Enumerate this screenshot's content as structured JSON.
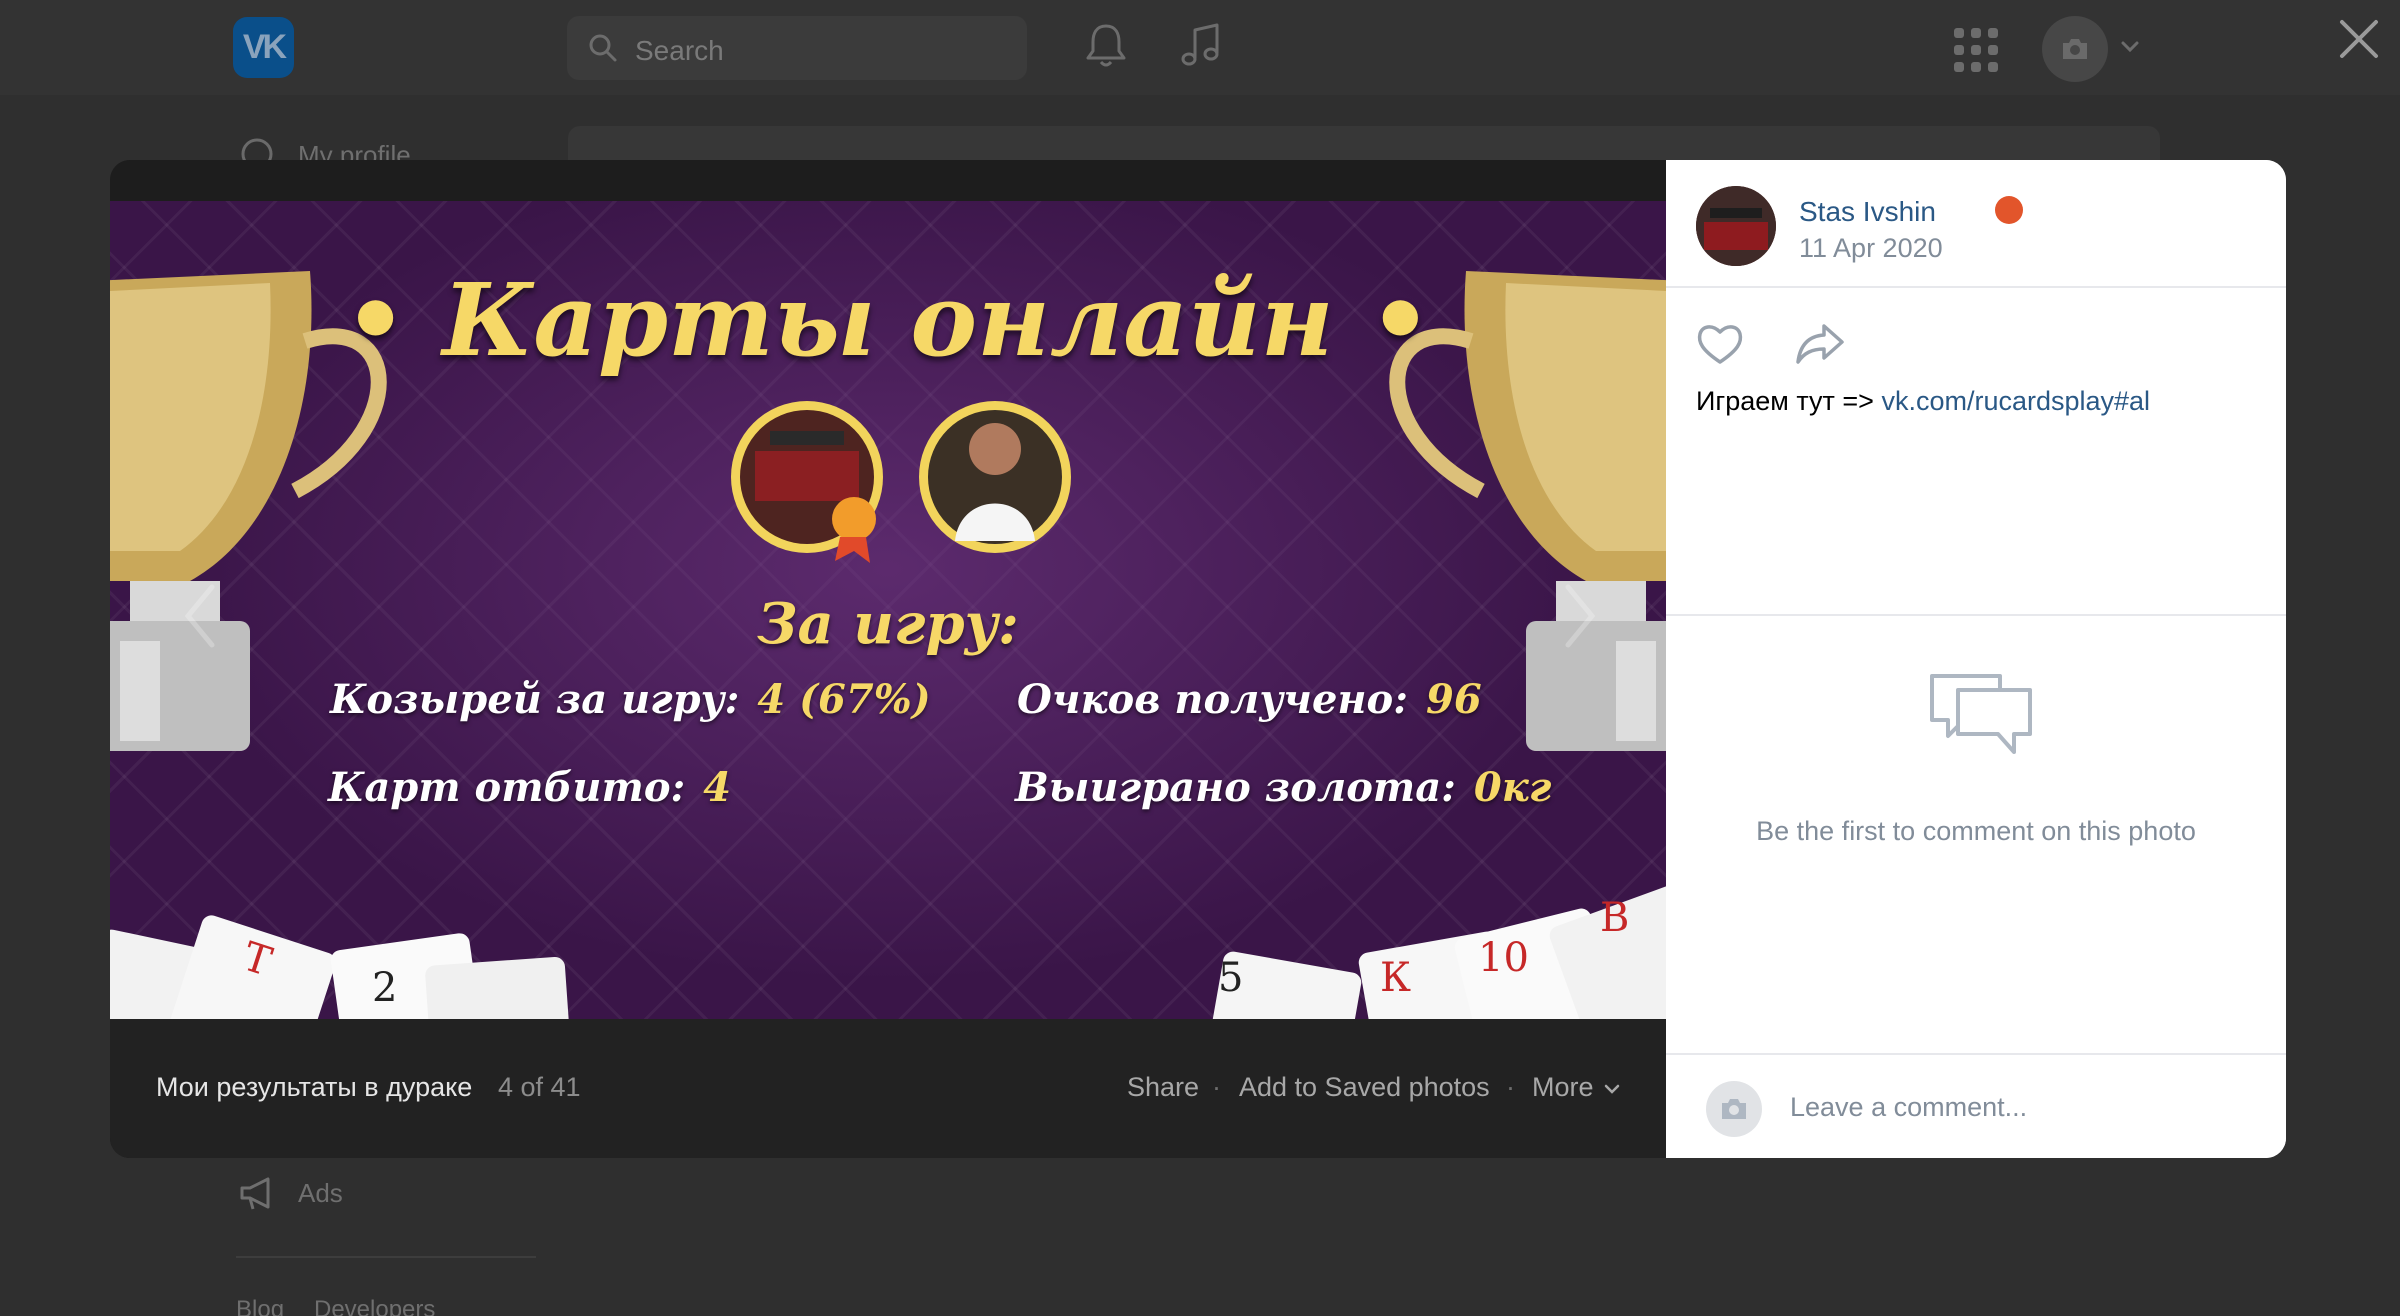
{
  "topbar": {
    "logo_text": "VK",
    "search": {
      "placeholder": "Search"
    },
    "icons": [
      "bell-icon",
      "music-icon",
      "apps-grid-icon",
      "camera-icon",
      "chevron-down-icon",
      "close-icon"
    ]
  },
  "background": {
    "sidebar_items": [
      {
        "label": "My profile",
        "icon": "profile-icon"
      },
      {
        "label": "Ads",
        "icon": "megaphone-icon"
      }
    ],
    "footer_links": [
      "Blog",
      "Developers"
    ]
  },
  "photo": {
    "title": "• Карты онлайн •",
    "section_label": "За игру:",
    "stats": [
      {
        "label": "Козырей за игру:",
        "value": "4 (67%)"
      },
      {
        "label": "Очков получено:",
        "value": "96"
      },
      {
        "label": "Карт отбито:",
        "value": "4"
      },
      {
        "label": "Выиграно золота:",
        "value": "0кг"
      }
    ],
    "caption": "Мои результаты в дураке",
    "counter": "4 of 41",
    "actions": {
      "share": "Share",
      "save": "Add to Saved photos",
      "more": "More"
    }
  },
  "panel": {
    "author_name": "Stas Ivshin",
    "author_emoji": "angry-face-emoji",
    "date": "11 Apr 2020",
    "post_text": "Играем тут => ",
    "post_link": "vk.com/rucardsplay#al",
    "empty_comments": "Be the first to comment on this photo",
    "comment_placeholder": "Leave a comment..."
  },
  "colors": {
    "vk_blue": "#2a5885",
    "muted_text": "#818c99",
    "gold": "#f6d867",
    "photo_purple": "#3a1548"
  }
}
